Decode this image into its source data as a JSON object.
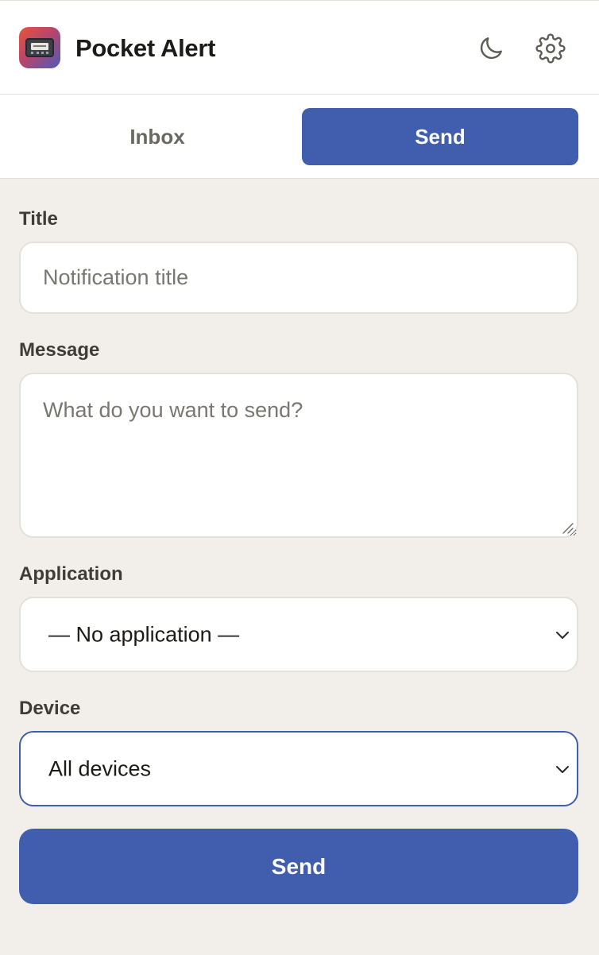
{
  "header": {
    "app_title": "Pocket Alert",
    "logo_icon": "pager-icon",
    "dark_mode_icon": "moon-icon",
    "settings_icon": "gear-icon"
  },
  "tabs": [
    {
      "label": "Inbox",
      "active": false
    },
    {
      "label": "Send",
      "active": true
    }
  ],
  "form": {
    "title_label": "Title",
    "title_placeholder": "Notification title",
    "title_value": "",
    "message_label": "Message",
    "message_placeholder": "What do you want to send?",
    "message_value": "",
    "application_label": "Application",
    "application_selected": "— No application —",
    "device_label": "Device",
    "device_selected": "All devices",
    "send_label": "Send"
  },
  "colors": {
    "accent": "#405dae",
    "background": "#f2efeb",
    "surface": "#ffffff",
    "border": "#e4e0da"
  }
}
